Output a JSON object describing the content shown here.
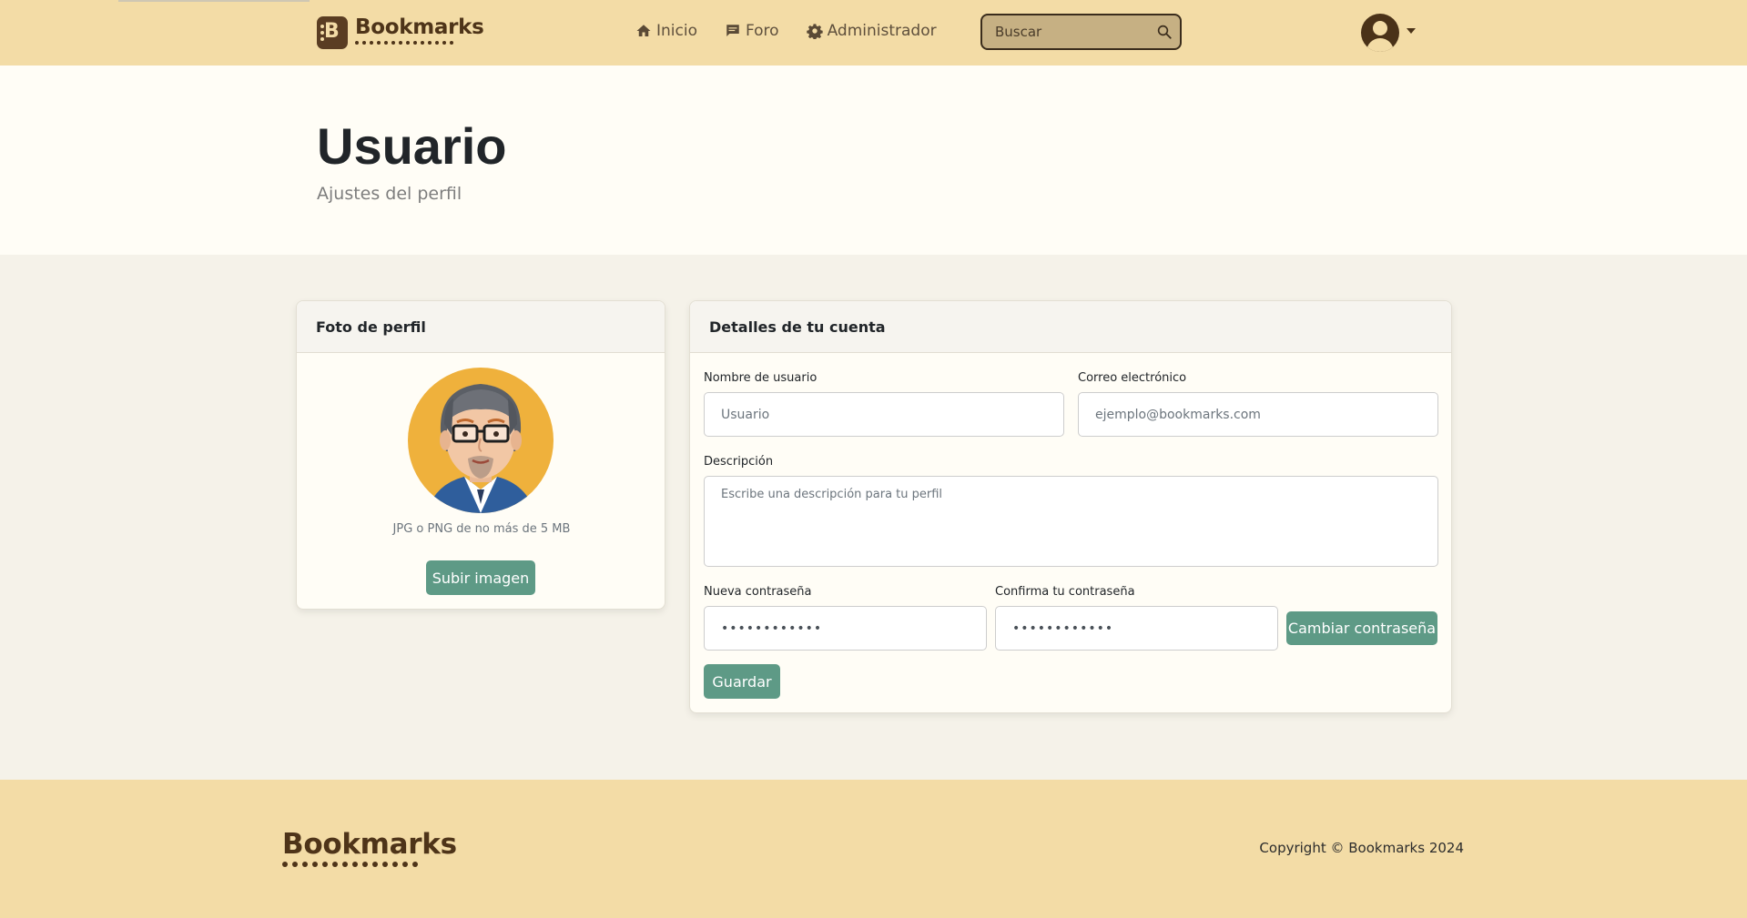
{
  "nav": {
    "brand": "Bookmarks",
    "brand_icon_letter": "B",
    "links": [
      {
        "label": "Inicio",
        "icon": "home-icon"
      },
      {
        "label": "Foro",
        "icon": "chat-icon"
      },
      {
        "label": "Administrador",
        "icon": "gear-icon"
      }
    ],
    "search_placeholder": "Buscar",
    "search_icon": "search-icon",
    "user_icon": "user-avatar-icon",
    "dropdown_icon": "caret-down-icon"
  },
  "header": {
    "title": "Usuario",
    "subtitle": "Ajustes del perfil"
  },
  "profile_card": {
    "title": "Foto de perfil",
    "hint": "JPG o PNG de no más de 5 MB",
    "upload_button": "Subir imagen"
  },
  "account_card": {
    "title": "Detalles de tu cuenta",
    "username_label": "Nombre de usuario",
    "username_placeholder": "Usuario",
    "email_label": "Correo electrónico",
    "email_placeholder": "ejemplo@bookmarks.com",
    "description_label": "Descripción",
    "description_placeholder": "Escribe una descripción para tu perfil",
    "new_password_label": "Nueva contraseña",
    "new_password_value": "••••••••••••",
    "confirm_password_label": "Confirma tu contraseña",
    "confirm_password_value": "••••••••••••",
    "change_password_button": "Cambiar contraseña",
    "save_button": "Guardar"
  },
  "footer": {
    "brand": "Bookmarks",
    "copyright": "Copyright © Bookmarks 2024"
  },
  "colors": {
    "navbar": "#f3dca6",
    "brand_brown": "#4e3419",
    "button_green": "#5e9a86",
    "page_bg": "#f5f2e9"
  }
}
